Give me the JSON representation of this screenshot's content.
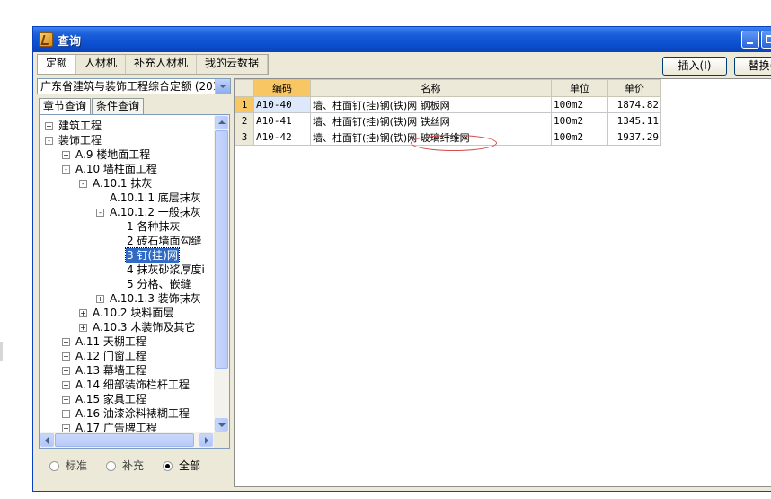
{
  "window": {
    "title": "查询"
  },
  "top_tabs": [
    {
      "label": "定额",
      "active": true
    },
    {
      "label": "人材机",
      "active": false
    },
    {
      "label": "补充人材机",
      "active": false
    },
    {
      "label": "我的云数据",
      "active": false
    }
  ],
  "buttons": {
    "insert": "插入(I)",
    "replace": "替换("
  },
  "quota_select": {
    "value": "广东省建筑与装饰工程综合定额 (201"
  },
  "sub_tabs": [
    {
      "label": "章节查询",
      "active": true
    },
    {
      "label": "条件查询",
      "active": false
    }
  ],
  "tree": [
    {
      "label": "建筑工程",
      "level": 0,
      "expander": "+"
    },
    {
      "label": "装饰工程",
      "level": 0,
      "expander": "-"
    },
    {
      "label": "A.9 楼地面工程",
      "level": 1,
      "expander": "+"
    },
    {
      "label": "A.10 墙柱面工程",
      "level": 1,
      "expander": "-"
    },
    {
      "label": "A.10.1 抹灰",
      "level": 2,
      "expander": "-"
    },
    {
      "label": "A.10.1.1 底层抹灰",
      "level": 3,
      "expander": ""
    },
    {
      "label": "A.10.1.2 一般抹灰",
      "level": 3,
      "expander": "-"
    },
    {
      "label": "1 各种抹灰",
      "level": 4,
      "expander": ""
    },
    {
      "label": "2 砖石墙面勾缝",
      "level": 4,
      "expander": ""
    },
    {
      "label": "3 钉(挂)网",
      "level": 4,
      "expander": "",
      "selected": true
    },
    {
      "label": "4 抹灰砂浆厚度i",
      "level": 4,
      "expander": ""
    },
    {
      "label": "5 分格、嵌缝",
      "level": 4,
      "expander": ""
    },
    {
      "label": "A.10.1.3 装饰抹灰",
      "level": 3,
      "expander": "+"
    },
    {
      "label": "A.10.2 块料面层",
      "level": 2,
      "expander": "+"
    },
    {
      "label": "A.10.3 木装饰及其它",
      "level": 2,
      "expander": "+"
    },
    {
      "label": "A.11 天棚工程",
      "level": 1,
      "expander": "+"
    },
    {
      "label": "A.12 门窗工程",
      "level": 1,
      "expander": "+"
    },
    {
      "label": "A.13 幕墙工程",
      "level": 1,
      "expander": "+"
    },
    {
      "label": "A.14 细部装饰栏杆工程",
      "level": 1,
      "expander": "+"
    },
    {
      "label": "A.15 家具工程",
      "level": 1,
      "expander": "+"
    },
    {
      "label": "A.16 油漆涂料裱糊工程",
      "level": 1,
      "expander": "+"
    },
    {
      "label": "A.17 广告牌工程",
      "level": 1,
      "expander": "+"
    }
  ],
  "filter": [
    {
      "label": "标准",
      "checked": false
    },
    {
      "label": "补充",
      "checked": false
    },
    {
      "label": "全部",
      "checked": true
    }
  ],
  "table": {
    "columns": [
      "编码",
      "名称",
      "单位",
      "单价"
    ],
    "rows": [
      {
        "num": "1",
        "code": "A10-40",
        "name": "墙、柱面钉(挂)钢(铁)网 钢板网",
        "unit": "100m2",
        "price": "1874.82",
        "current": true
      },
      {
        "num": "2",
        "code": "A10-41",
        "name": "墙、柱面钉(挂)钢(铁)网 铁丝网",
        "unit": "100m2",
        "price": "1345.11"
      },
      {
        "num": "3",
        "code": "A10-42",
        "name": "墙、柱面钉(挂)钢(铁)网 玻璃纤维网",
        "unit": "100m2",
        "price": "1937.29"
      }
    ]
  }
}
